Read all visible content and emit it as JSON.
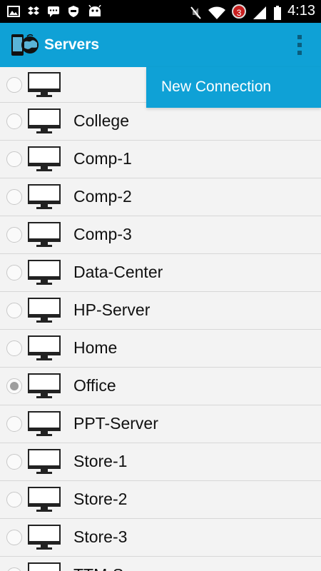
{
  "status_bar": {
    "time": "4:13",
    "notification_count": "3",
    "left_icons": [
      "image-icon",
      "dropbox-icon",
      "chat-icon",
      "shield-icon",
      "android-icon"
    ],
    "right_icons": [
      "mute-icon",
      "wifi-icon",
      "notification-badge-icon",
      "signal-icon",
      "battery-icon"
    ]
  },
  "action_bar": {
    "title": "Servers",
    "logo_icon": "phone-globe-icon",
    "overflow_icon": "more-vert-icon",
    "color": "#0fa1d6"
  },
  "popup_menu": {
    "items": [
      {
        "label": "New Connection"
      }
    ]
  },
  "servers": [
    {
      "label": "",
      "selected": false
    },
    {
      "label": "College",
      "selected": false
    },
    {
      "label": "Comp-1",
      "selected": false
    },
    {
      "label": "Comp-2",
      "selected": false
    },
    {
      "label": "Comp-3",
      "selected": false
    },
    {
      "label": "Data-Center",
      "selected": false
    },
    {
      "label": "HP-Server",
      "selected": false
    },
    {
      "label": "Home",
      "selected": false
    },
    {
      "label": "Office",
      "selected": true
    },
    {
      "label": "PPT-Server",
      "selected": false
    },
    {
      "label": "Store-1",
      "selected": false
    },
    {
      "label": "Store-2",
      "selected": false
    },
    {
      "label": "Store-3",
      "selected": false
    },
    {
      "label": "TTM-S",
      "selected": false
    }
  ]
}
